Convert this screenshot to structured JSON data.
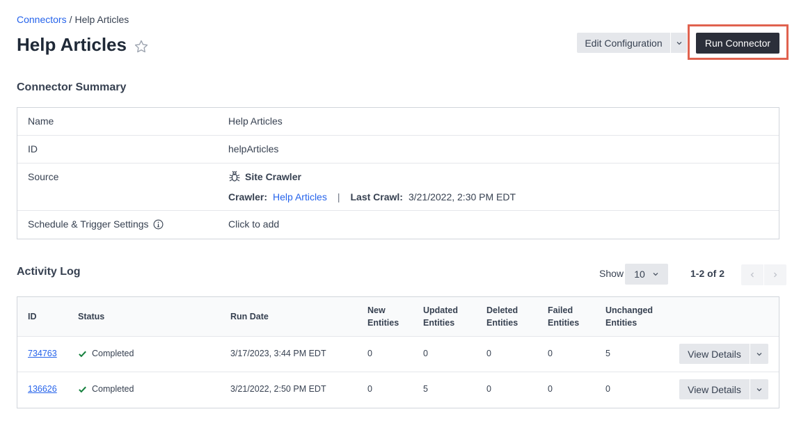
{
  "breadcrumb": {
    "parent": "Connectors",
    "separator": "/",
    "current": "Help Articles"
  },
  "page": {
    "title": "Help Articles"
  },
  "actions": {
    "edit_label": "Edit Configuration",
    "run_label": "Run Connector"
  },
  "summary": {
    "title": "Connector Summary",
    "name_label": "Name",
    "name_value": "Help Articles",
    "id_label": "ID",
    "id_value": "helpArticles",
    "source_label": "Source",
    "source_value": "Site Crawler",
    "crawler_label": "Crawler:",
    "crawler_link": "Help Articles",
    "separator": "|",
    "last_crawl_label": "Last Crawl:",
    "last_crawl_value": "3/21/2022, 2:30 PM EDT",
    "schedule_label": "Schedule & Trigger Settings",
    "schedule_value": "Click to add"
  },
  "activity": {
    "title": "Activity Log",
    "show_label": "Show",
    "page_size": "10",
    "pager": "1-2 of 2",
    "columns": {
      "id": "ID",
      "status": "Status",
      "run_date": "Run Date",
      "new_1": "New",
      "new_2": "Entities",
      "updated_1": "Updated",
      "updated_2": "Entities",
      "deleted_1": "Deleted",
      "deleted_2": "Entities",
      "failed_1": "Failed",
      "failed_2": "Entities",
      "unchanged_1": "Unchanged",
      "unchanged_2": "Entities"
    },
    "view_details_label": "View Details",
    "rows": [
      {
        "id": "734763",
        "status": "Completed",
        "run_date": "3/17/2023, 3:44 PM EDT",
        "new": "0",
        "updated": "0",
        "deleted": "0",
        "failed": "0",
        "unchanged": "5"
      },
      {
        "id": "136626",
        "status": "Completed",
        "run_date": "3/21/2022, 2:50 PM EDT",
        "new": "0",
        "updated": "5",
        "deleted": "0",
        "failed": "0",
        "unchanged": "0"
      }
    ]
  },
  "colors": {
    "link": "#2563eb",
    "primary_button": "#2b2f3a",
    "highlight": "#e0624f",
    "success": "#15803d"
  }
}
